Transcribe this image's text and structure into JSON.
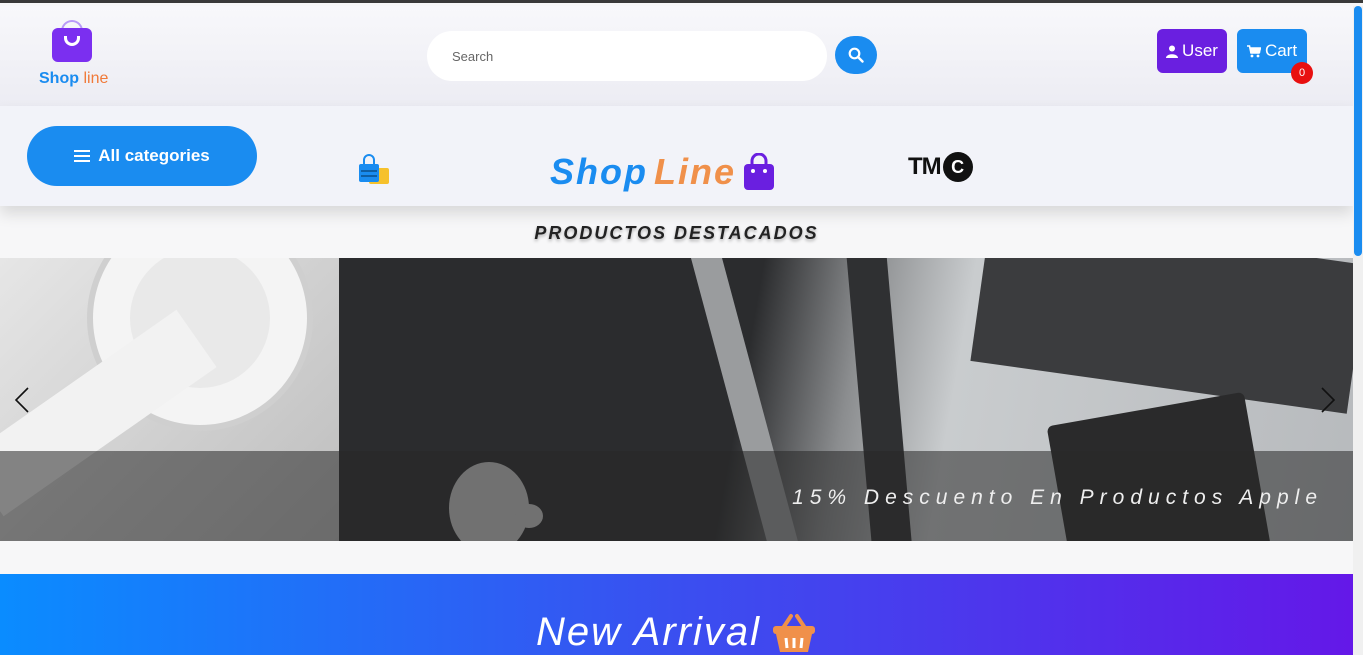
{
  "header": {
    "logo": {
      "word1": "Shop",
      "word2": "line"
    },
    "search": {
      "placeholder": "Search"
    },
    "user_label": "User",
    "cart_label": "Cart",
    "cart_count": "0"
  },
  "nav": {
    "all_categories_label": "All categories",
    "brands": {
      "center_part1": "Shop",
      "center_part2": "Line",
      "tmc_tm": "TM",
      "tmc_c": "C"
    }
  },
  "featured": {
    "title": "PRODUCTOS DESTACADOS",
    "slide_caption": "15% Descuento En Productos Apple"
  },
  "new_arrival": {
    "title": "New Arrival"
  },
  "colors": {
    "primary_blue": "#1a8cf0",
    "purple": "#6a1fe0",
    "badge_red": "#e81010",
    "orange": "#f0904a"
  },
  "icons": {
    "search_button": "search-icon",
    "user_button": "user-icon",
    "cart_button": "cart-icon",
    "categories": "hamburger-icon",
    "new_arrival": "basket-icon"
  }
}
